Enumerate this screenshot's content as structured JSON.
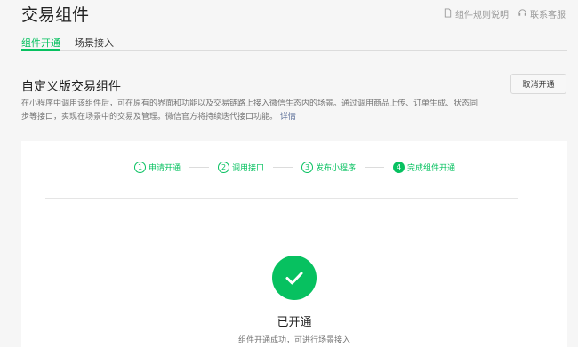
{
  "header": {
    "title": "交易组件",
    "rules_link": "组件规则说明",
    "service_link": "联系客服"
  },
  "tabs": [
    {
      "label": "组件开通",
      "active": true
    },
    {
      "label": "场景接入",
      "active": false
    }
  ],
  "section": {
    "title": "自定义版交易组件",
    "cancel_button": "取消开通",
    "description": "在小程序中调用该组件后，可在原有的界面和功能以及交易链路上接入微信生态内的场景。通过调用商品上传、订单生成、状态同步等接口，实现在场景中的交易及管理。微信官方将持续迭代接口功能。",
    "detail_link": "详情"
  },
  "steps": [
    {
      "num": "1",
      "label": "申请开通"
    },
    {
      "num": "2",
      "label": "调用接口"
    },
    {
      "num": "3",
      "label": "发布小程序"
    },
    {
      "num": "4",
      "label": "完成组件开通"
    }
  ],
  "status": {
    "title": "已开通",
    "description": "组件开通成功，可进行场景接入"
  },
  "colors": {
    "accent": "#07c160",
    "link": "#576b95"
  }
}
